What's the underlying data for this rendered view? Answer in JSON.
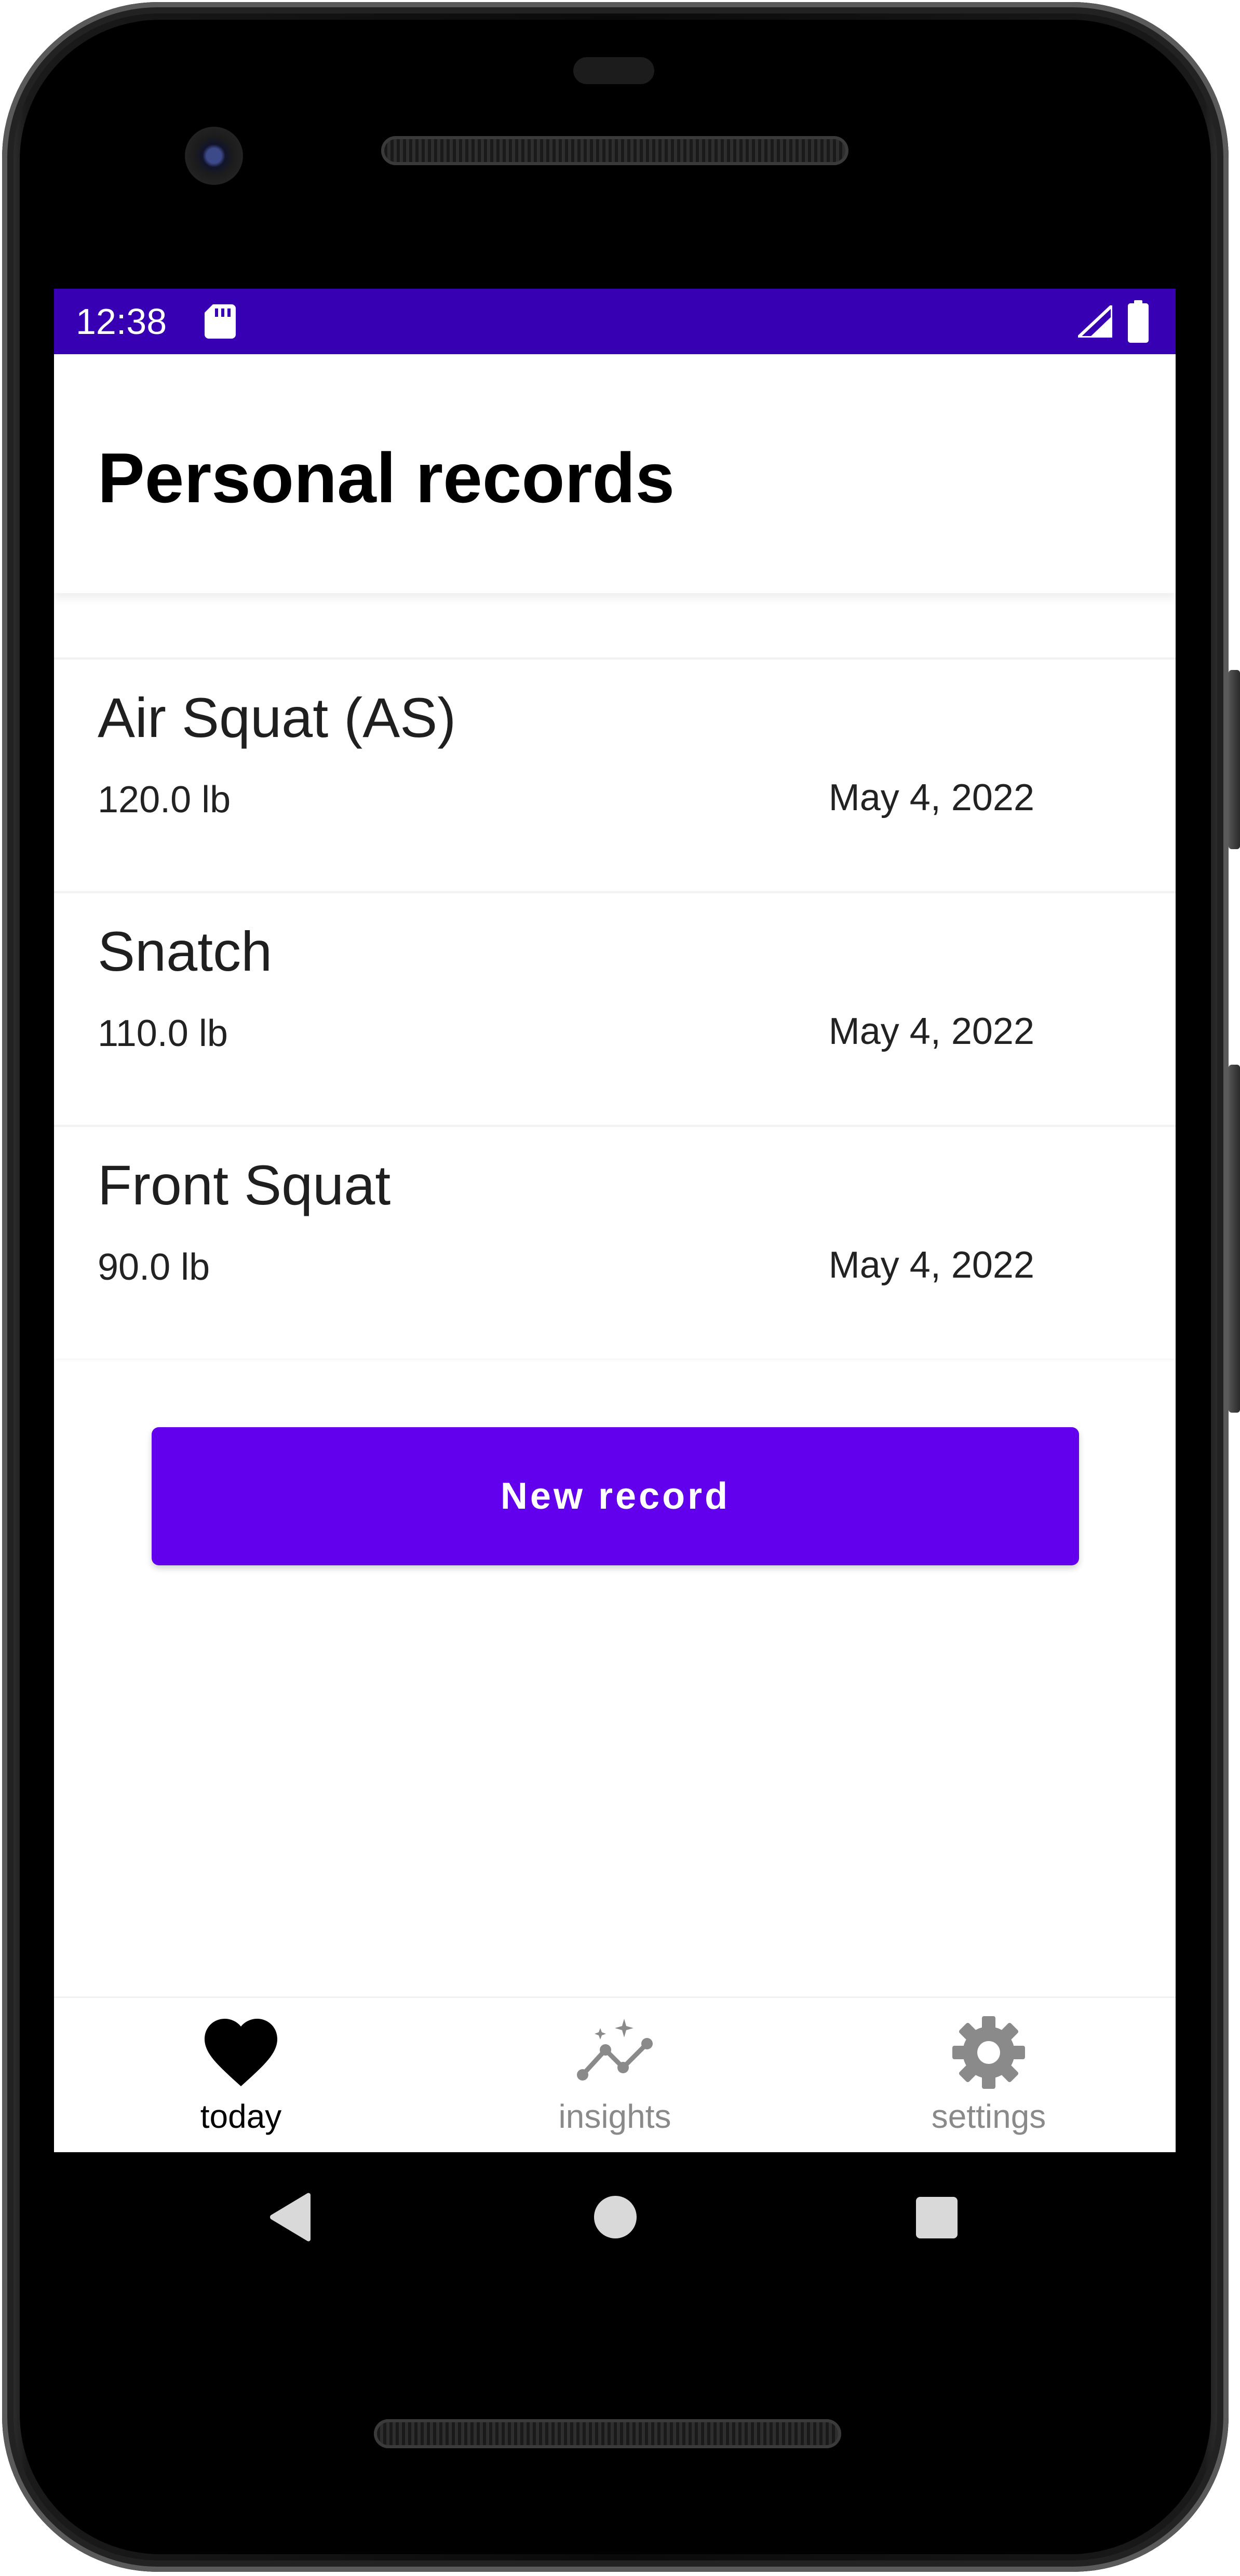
{
  "status_bar": {
    "time": "12:38",
    "color": "#3700b3",
    "icons": [
      "sd-card-icon",
      "signal-icon",
      "battery-icon"
    ]
  },
  "header": {
    "title": "Personal records"
  },
  "records": [
    {
      "name": "Air Squat (AS)",
      "weight": "120.0 lb",
      "date": "May 4, 2022"
    },
    {
      "name": "Snatch",
      "weight": "110.0 lb",
      "date": "May 4, 2022"
    },
    {
      "name": "Front Squat",
      "weight": "90.0 lb",
      "date": "May 4, 2022"
    }
  ],
  "actions": {
    "new_record_label": "New record",
    "accent_color": "#6200ee"
  },
  "bottom_nav": {
    "items": [
      {
        "label": "today",
        "icon": "heart-icon",
        "selected": true,
        "color": "#000000"
      },
      {
        "label": "insights",
        "icon": "insights-chart-icon",
        "selected": false,
        "color": "#8a8a8a"
      },
      {
        "label": "settings",
        "icon": "gear-icon",
        "selected": false,
        "color": "#8a8a8a"
      }
    ]
  },
  "system_nav": {
    "icons": [
      "back-icon",
      "home-icon",
      "recents-icon"
    ]
  }
}
